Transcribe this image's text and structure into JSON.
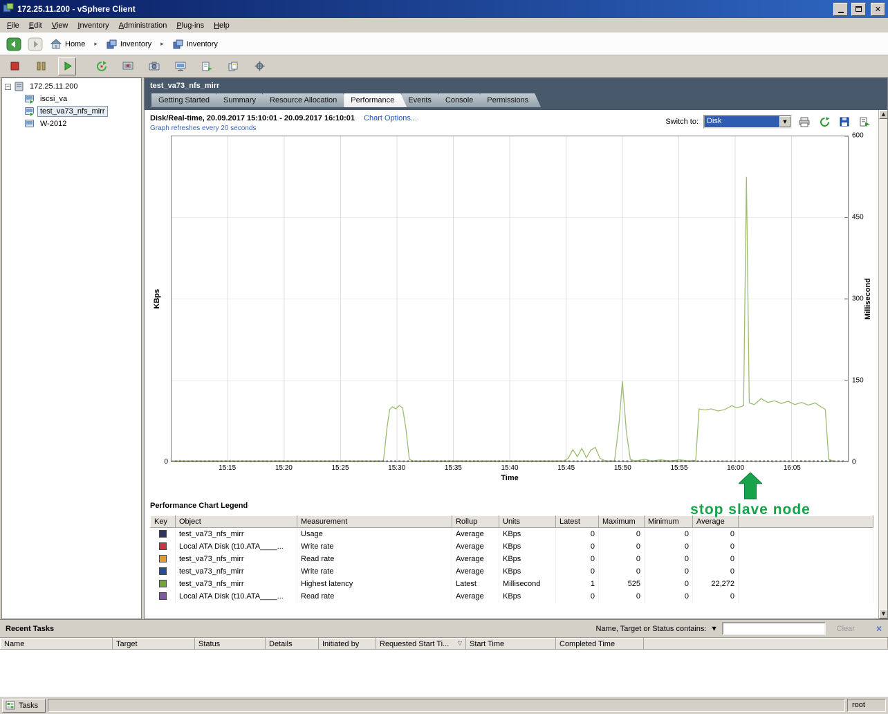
{
  "window": {
    "title": "172.25.11.200 - vSphere Client"
  },
  "menubar": {
    "items": [
      "File",
      "Edit",
      "View",
      "Inventory",
      "Administration",
      "Plug-ins",
      "Help"
    ]
  },
  "breadcrumb": {
    "home": "Home",
    "inventory": "Inventory",
    "inventory2": "Inventory"
  },
  "toolbar": {
    "buttons": [
      "power-off",
      "suspend",
      "power-on",
      "reset",
      "shutdown-guest",
      "take-snapshot",
      "open-console",
      "migrate",
      "clone",
      "edit-settings"
    ]
  },
  "tree": {
    "root": "172.25.11.200",
    "items": [
      {
        "label": "iscsi_va"
      },
      {
        "label": "test_va73_nfs_mirr",
        "selected": true
      },
      {
        "label": "W-2012"
      }
    ]
  },
  "entity": {
    "title": "test_va73_nfs_mirr"
  },
  "tabs": {
    "items": [
      "Getting Started",
      "Summary",
      "Resource Allocation",
      "Performance",
      "Events",
      "Console",
      "Permissions"
    ],
    "active": "Performance"
  },
  "chart_header": {
    "title": "Disk/Real-time, 20.09.2017 15:10:01 - 20.09.2017 16:10:01",
    "options_link": "Chart Options...",
    "refresh_note": "Graph refreshes every 20 seconds",
    "switch_label": "Switch to:",
    "switch_value": "Disk",
    "icons": [
      "print-icon",
      "refresh-icon",
      "save-icon",
      "export-icon"
    ]
  },
  "chart_data": {
    "type": "line",
    "title": "Disk/Real-time",
    "xlabel": "Time",
    "ylabel_left": "KBps",
    "ylabel_right": "Millisecond",
    "left_axis_zero_label": "0",
    "x_range_minutes": [
      0,
      60
    ],
    "x_tick_minutes": [
      5,
      10,
      15,
      20,
      25,
      30,
      35,
      40,
      45,
      50,
      55
    ],
    "x_tick_labels": [
      "15:15",
      "15:20",
      "15:25",
      "15:30",
      "15:35",
      "15:40",
      "15:45",
      "15:50",
      "15:55",
      "16:00",
      "16:05"
    ],
    "ylim": [
      0,
      600
    ],
    "y_right_ticks": [
      0,
      150,
      300,
      450,
      600
    ],
    "grid": true,
    "legend_position": "bottom-table",
    "series": [
      {
        "name": "test_va73_nfs_mirr - Highest latency (Millisecond)",
        "color": "#9cbd70",
        "points": [
          [
            0,
            1
          ],
          [
            3,
            1
          ],
          [
            6,
            1
          ],
          [
            9,
            1
          ],
          [
            12,
            1
          ],
          [
            15,
            1
          ],
          [
            18,
            1
          ],
          [
            18.8,
            1
          ],
          [
            19.1,
            60
          ],
          [
            19.35,
            96
          ],
          [
            19.6,
            101
          ],
          [
            19.9,
            97
          ],
          [
            20.2,
            103
          ],
          [
            20.5,
            99
          ],
          [
            20.8,
            60
          ],
          [
            21.1,
            4
          ],
          [
            21.4,
            1
          ],
          [
            24,
            1
          ],
          [
            27,
            1
          ],
          [
            30,
            1
          ],
          [
            33,
            1
          ],
          [
            34.8,
            1
          ],
          [
            35.2,
            6
          ],
          [
            35.6,
            22
          ],
          [
            36,
            9
          ],
          [
            36.4,
            24
          ],
          [
            36.8,
            7
          ],
          [
            37.2,
            21
          ],
          [
            37.6,
            26
          ],
          [
            38,
            6
          ],
          [
            38.5,
            1
          ],
          [
            39.3,
            1
          ],
          [
            39.7,
            70
          ],
          [
            40,
            148
          ],
          [
            40.35,
            55
          ],
          [
            40.7,
            4
          ],
          [
            41.1,
            1
          ],
          [
            42,
            4
          ],
          [
            42.6,
            1
          ],
          [
            43.4,
            3
          ],
          [
            44.2,
            1
          ],
          [
            45.1,
            3
          ],
          [
            45.9,
            1
          ],
          [
            46.5,
            2
          ],
          [
            46.8,
            97
          ],
          [
            47.3,
            95
          ],
          [
            47.9,
            97
          ],
          [
            48.5,
            93
          ],
          [
            49.1,
            96
          ],
          [
            49.7,
            103
          ],
          [
            50.1,
            99
          ],
          [
            50.5,
            101
          ],
          [
            50.75,
            103
          ],
          [
            51,
            525
          ],
          [
            51.25,
            108
          ],
          [
            51.7,
            105
          ],
          [
            52.3,
            116
          ],
          [
            52.9,
            109
          ],
          [
            53.5,
            112
          ],
          [
            54.1,
            107
          ],
          [
            54.7,
            111
          ],
          [
            55.3,
            105
          ],
          [
            55.9,
            109
          ],
          [
            56.5,
            104
          ],
          [
            57.1,
            108
          ],
          [
            57.6,
            101
          ],
          [
            58,
            96
          ],
          [
            58.3,
            4
          ],
          [
            58.7,
            1
          ]
        ]
      },
      {
        "name": "all other counters (flat at 0)",
        "color": "#5a6352",
        "dashed": true,
        "points": [
          [
            0.3,
            1
          ],
          [
            59.7,
            1
          ]
        ]
      }
    ],
    "annotation": {
      "text": "stop slave node",
      "color": "#17a24b",
      "x_minute": 51
    }
  },
  "legend": {
    "title": "Performance Chart Legend",
    "columns": [
      "Key",
      "Object",
      "Measurement",
      "Rollup",
      "Units",
      "Latest",
      "Maximum",
      "Minimum",
      "Average"
    ],
    "rows": [
      {
        "key_color": "#2e3360",
        "object": "test_va73_nfs_mirr",
        "measurement": "Usage",
        "rollup": "Average",
        "units": "KBps",
        "latest": "0",
        "maximum": "0",
        "minimum": "0",
        "average": "0"
      },
      {
        "key_color": "#cc3344",
        "object": "Local ATA Disk (t10.ATA____...",
        "measurement": "Write rate",
        "rollup": "Average",
        "units": "KBps",
        "latest": "0",
        "maximum": "0",
        "minimum": "0",
        "average": "0"
      },
      {
        "key_color": "#e39a2e",
        "object": "test_va73_nfs_mirr",
        "measurement": "Read rate",
        "rollup": "Average",
        "units": "KBps",
        "latest": "0",
        "maximum": "0",
        "minimum": "0",
        "average": "0"
      },
      {
        "key_color": "#2a4a9e",
        "object": "test_va73_nfs_mirr",
        "measurement": "Write rate",
        "rollup": "Average",
        "units": "KBps",
        "latest": "0",
        "maximum": "0",
        "minimum": "0",
        "average": "0"
      },
      {
        "key_color": "#74a437",
        "object": "test_va73_nfs_mirr",
        "measurement": "Highest latency",
        "rollup": "Latest",
        "units": "Millisecond",
        "latest": "1",
        "maximum": "525",
        "minimum": "0",
        "average": "22,272"
      },
      {
        "key_color": "#7d58a4",
        "object": "Local ATA Disk (t10.ATA____...",
        "measurement": "Read rate",
        "rollup": "Average",
        "units": "KBps",
        "latest": "0",
        "maximum": "0",
        "minimum": "0",
        "average": "0"
      }
    ]
  },
  "recent_tasks": {
    "title": "Recent Tasks",
    "filter_label": "Name, Target or Status contains:",
    "filter_value": "",
    "clear_label": "Clear",
    "columns": [
      "Name",
      "Target",
      "Status",
      "Details",
      "Initiated by",
      "Requested Start Ti...",
      "Start Time",
      "Completed Time"
    ]
  },
  "statusbar": {
    "tasks_label": "Tasks",
    "user": "root"
  }
}
